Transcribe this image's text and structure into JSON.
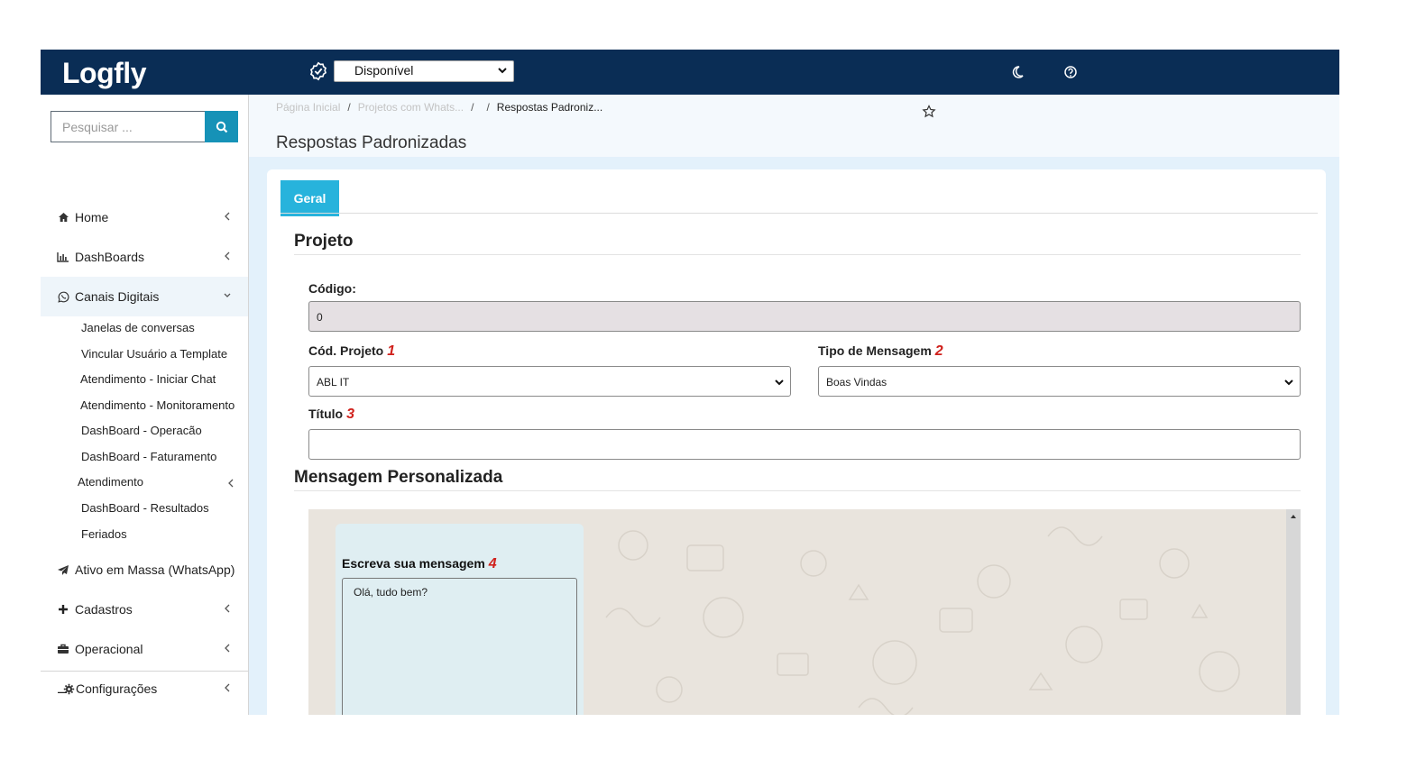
{
  "app": {
    "logo_text": "Logfly",
    "status": {
      "selected": "Disponível"
    }
  },
  "sidebar": {
    "search_placeholder": "Pesquisar ...",
    "items": [
      {
        "label": "Home",
        "icon": "home-icon"
      },
      {
        "label": "DashBoards",
        "icon": "bar-chart-icon"
      },
      {
        "label": "Canais Digitais",
        "icon": "whatsapp-icon",
        "expanded": true
      },
      {
        "label": "Ativo em Massa (WhatsApp)",
        "icon": "paper-plane-icon"
      },
      {
        "label": "Cadastros",
        "icon": "plus-icon"
      },
      {
        "label": "Operacional",
        "icon": "briefcase-icon"
      },
      {
        "label": "Configurações",
        "icon": "gear-icon"
      }
    ],
    "subitems": [
      "Janelas de conversas",
      "Vincular Usuário a Template",
      "Atendimento - Iniciar Chat",
      "Atendimento - Monitoramento",
      "DashBoard - Operacão",
      "DashBoard - Faturamento",
      "Atendimento",
      "DashBoard - Resultados",
      "Feriados"
    ],
    "footer_label": "–"
  },
  "breadcrumb": {
    "home": "Página Inicial",
    "parent": "Projetos com Whats...",
    "sep1": "/",
    "sep2": "/",
    "sep3": "/",
    "current": "Respostas Padroniz..."
  },
  "page_title": "Respostas Padronizadas",
  "tabs": [
    {
      "label": "Geral"
    }
  ],
  "form": {
    "section_projeto": "Projeto",
    "codigo_label": "Código:",
    "codigo_value": "0",
    "cod_projeto_label": "Cód. Projeto",
    "cod_projeto_num": "1",
    "cod_projeto_value": "ABL IT",
    "tipo_label": "Tipo de Mensagem",
    "tipo_num": "2",
    "tipo_value": "Boas Vindas",
    "titulo_label": "Título",
    "titulo_num": "3",
    "titulo_value": "",
    "section_mensagem": "Mensagem Personalizada",
    "msg_label": "Escreva sua mensagem",
    "msg_num": "4",
    "msg_value": "Olá, tudo bem?"
  },
  "colors": {
    "topbar": "#0a2d55",
    "accent": "#27b3dc",
    "search_button": "#1692b7",
    "annotation": "#d0211c"
  }
}
